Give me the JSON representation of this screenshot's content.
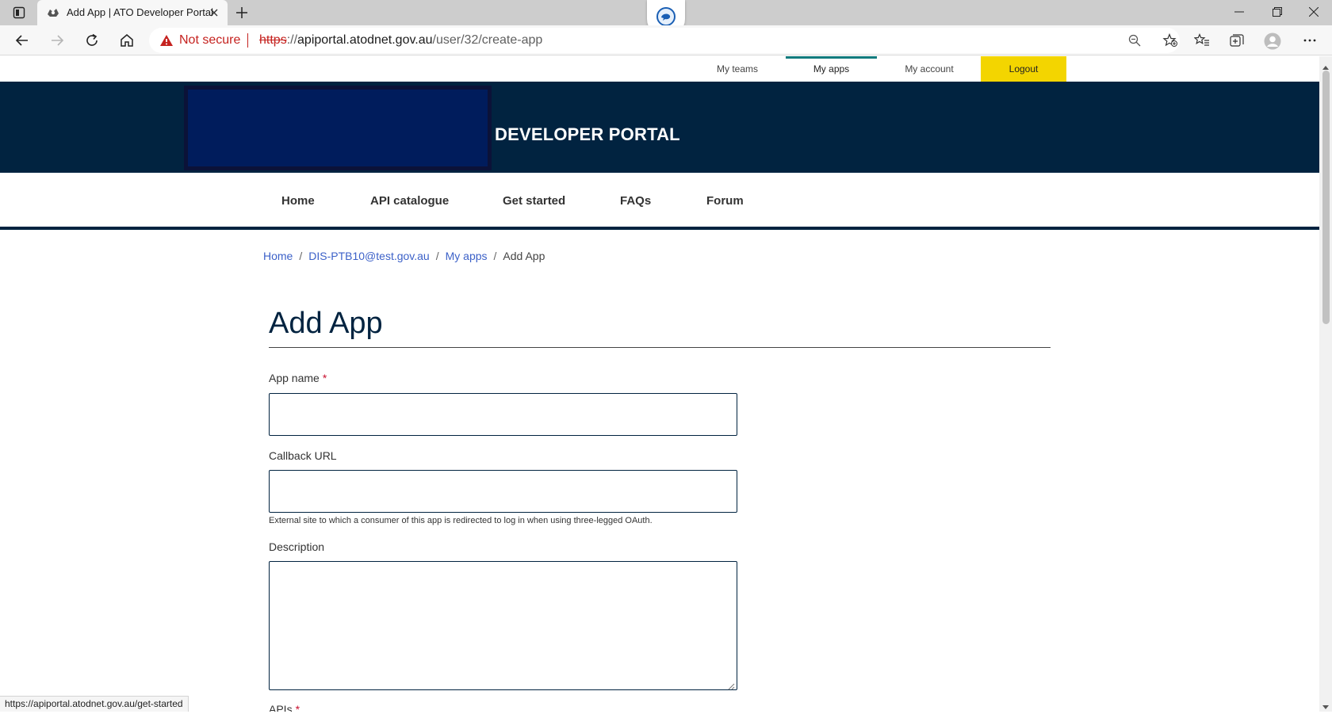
{
  "browser": {
    "tab_title": "Add App | ATO Developer Portal",
    "security_label": "Not secure",
    "url_scheme": "https",
    "url_sep": "://",
    "url_host": "apiportal.atodnet.gov.au",
    "url_path": "/user/32/create-app",
    "status_url": "https://apiportal.atodnet.gov.au/get-started"
  },
  "utility_nav": {
    "items": [
      {
        "label": "My teams"
      },
      {
        "label": "My apps"
      },
      {
        "label": "My account"
      },
      {
        "label": "Logout"
      }
    ],
    "active": "My apps",
    "active_color": "#0f7b7d",
    "logout_color": "#f3d500"
  },
  "header": {
    "title": "DEVELOPER PORTAL",
    "banner_color": "#012340"
  },
  "main_nav": {
    "items": [
      {
        "label": "Home"
      },
      {
        "label": "API catalogue"
      },
      {
        "label": "Get started"
      },
      {
        "label": "FAQs"
      },
      {
        "label": "Forum"
      }
    ]
  },
  "breadcrumb": {
    "items": [
      {
        "label": "Home"
      },
      {
        "label": "DIS-PTB10@test.gov.au"
      },
      {
        "label": "My apps"
      }
    ],
    "separator": "/",
    "current": "Add App"
  },
  "form": {
    "heading": "Add App",
    "app_name": {
      "label": "App name",
      "required_mark": "*",
      "value": ""
    },
    "callback_url": {
      "label": "Callback URL",
      "value": "",
      "help": "External site to which a consumer of this app is redirected to log in when using three-legged OAuth."
    },
    "description": {
      "label": "Description",
      "value": ""
    },
    "apis": {
      "label": "APIs",
      "required_mark": "*"
    }
  },
  "icons": {
    "tab_actions": "tab-actions-icon",
    "favicon": "ato-crest-icon",
    "extension": "chat-extension-icon",
    "warning": "warning-icon"
  }
}
